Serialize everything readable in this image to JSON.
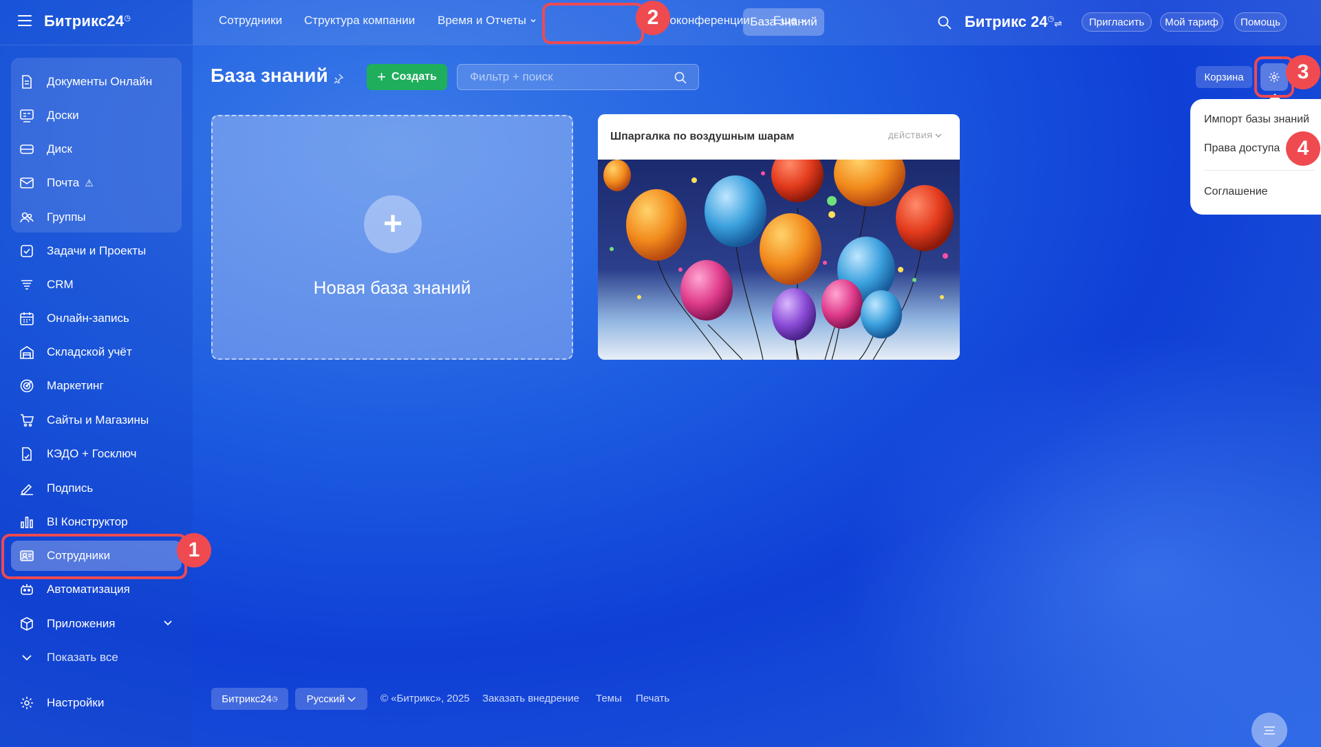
{
  "sidebar": {
    "logo": "Битрикс24",
    "logo_mark": "◷",
    "items": [
      {
        "label": "Документы Онлайн",
        "icon": "document-icon"
      },
      {
        "label": "Доски",
        "icon": "board-icon"
      },
      {
        "label": "Диск",
        "icon": "disk-icon"
      },
      {
        "label": "Почта",
        "icon": "mail-icon",
        "warning": "⚠"
      },
      {
        "label": "Группы",
        "icon": "groups-icon"
      },
      {
        "label": "Задачи и Проекты",
        "icon": "tasks-icon"
      },
      {
        "label": "CRM",
        "icon": "crm-icon"
      },
      {
        "label": "Онлайн-запись",
        "icon": "calendar-icon"
      },
      {
        "label": "Складской учёт",
        "icon": "warehouse-icon"
      },
      {
        "label": "Маркетинг",
        "icon": "marketing-icon"
      },
      {
        "label": "Сайты и Магазины",
        "icon": "cart-icon"
      },
      {
        "label": "КЭДО + Госключ",
        "icon": "edo-icon"
      },
      {
        "label": "Подпись",
        "icon": "signature-icon"
      },
      {
        "label": "BI Конструктор",
        "icon": "chart-icon"
      },
      {
        "label": "Сотрудники",
        "icon": "employees-icon",
        "active": true
      },
      {
        "label": "Автоматизация",
        "icon": "robot-icon"
      },
      {
        "label": "Приложения",
        "icon": "apps-icon"
      },
      {
        "label": "Показать все",
        "icon": "chevron-down-icon"
      }
    ],
    "settings": "Настройки"
  },
  "topnav": {
    "items": [
      "Сотрудники",
      "Структура компании",
      "Время и Отчеты",
      "База знаний",
      "еоконференции",
      "Еще"
    ],
    "brand": "Битрикс 24",
    "brand_mark": "◷",
    "invite": "Пригласить",
    "tariff": "Мой тариф",
    "help": "Помощь"
  },
  "page": {
    "title": "База знаний",
    "create": "Создать",
    "search_placeholder": "Фильтр + поиск",
    "trash": "Корзина"
  },
  "dropdown": {
    "items": [
      "Импорт базы знаний",
      "Права доступа",
      "Соглашение"
    ]
  },
  "cards": {
    "new_title": "Новая база знаний",
    "kb_title": "Шпаргалка по воздушным шарам",
    "kb_actions": "ДЕЙСТВИЯ"
  },
  "footer": {
    "brand": "Битрикс24",
    "brand_mark": "◷",
    "lang": "Русский",
    "copyright": "© «Битрикс», 2025",
    "order": "Заказать внедрение",
    "themes": "Темы",
    "print": "Печать"
  },
  "annotations": {
    "b1": "1",
    "b2": "2",
    "b3": "3",
    "b4": "4"
  },
  "colors": {
    "accent_green": "#1fae5c",
    "highlight_red": "#ef4a50"
  }
}
